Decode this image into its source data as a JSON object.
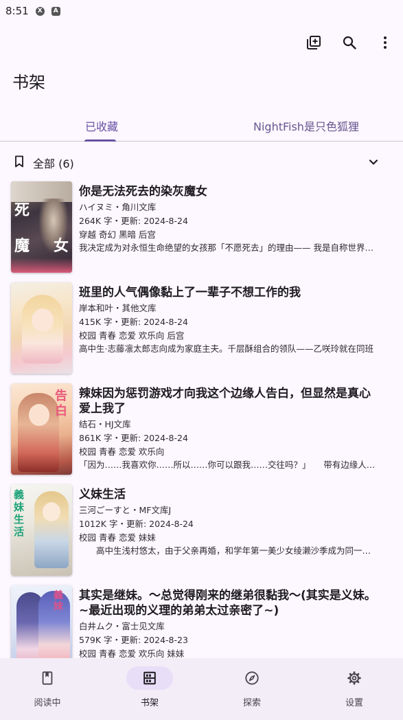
{
  "status_bar": {
    "time": "8:51",
    "icon_1": "X",
    "icon_2": "A"
  },
  "toolbar": {
    "actions": [
      "add-box-icon",
      "search-icon",
      "more-vert-icon"
    ]
  },
  "page_title": "书架",
  "tabs": [
    {
      "label": "已收藏",
      "selected": true
    },
    {
      "label": "NightFish是只色狐狸",
      "selected": false
    }
  ],
  "group": {
    "label": "全部 (6)"
  },
  "books": [
    {
      "title": "你是无法死去的染灰魔女",
      "author_line": "ハイヌミ・角川文库",
      "stats_line": "264K 字・更新: 2024-8-24",
      "tags": "穿越 奇幻 黑暗 后宫",
      "intro": "我决定成为对永恒生命绝望的女孩那「不愿死去」的理由—— 我是自称世界最强魔女的女孩",
      "cover_text": [
        "死",
        "魔",
        "女"
      ]
    },
    {
      "title": "班里的人气偶像黏上了一辈子不想工作的我",
      "author_line": "岸本和叶・其他文库",
      "stats_line": "415K 字・更新: 2024-8-24",
      "tags": "校园 青春 恋爱 欢乐向 后宫",
      "intro": "高中生·志藤凛太郎志向成为家庭主夫。千层酥组合的领队——乙咲玲就在同班",
      "cover_text": []
    },
    {
      "title": "辣妹因为惩罚游戏才向我这个边缘人告白，但显然是真心爱上我了",
      "author_line": "结石・HJ文库",
      "stats_line": "861K 字・更新: 2024-8-24",
      "tags": "校园 青春 恋爱 欢乐向",
      "intro": "「因为……我喜欢你……所以……你可以跟我……交往吗？」　　带有边缘人属性",
      "cover_text": [
        "告",
        "白"
      ]
    },
    {
      "title": "义妹生活",
      "author_line": "三河ごーすと・MF文库J",
      "stats_line": "1012K 字・更新: 2024-8-24",
      "tags": "校园 青春 恋爱 妹妹",
      "intro": "　　高中生浅村悠太，由于父亲再婚，和学年第一美少女绫濑沙季成为同一屋檐下的兄妹",
      "cover_text": [
        "義",
        "妹",
        "生",
        "活"
      ]
    },
    {
      "title": "其实是继妹。～总觉得刚来的继弟很黏我～(其实是义妹。~最近出现的义理的弟弟太过亲密了~)",
      "author_line": "白井ムク・富士见文库",
      "stats_line": "579K 字・更新: 2024-8-23",
      "tags": "校园 青春 恋爱 欢乐向 妹妹",
      "intro": "",
      "cover_text": [
        "義",
        "妹"
      ]
    }
  ],
  "bottom_nav": [
    {
      "label": "阅读中",
      "icon": "book-icon",
      "active": false
    },
    {
      "label": "书架",
      "icon": "bookshelf-icon",
      "active": true
    },
    {
      "label": "探索",
      "icon": "compass-icon",
      "active": false
    },
    {
      "label": "设置",
      "icon": "gear-icon",
      "active": false
    }
  ]
}
